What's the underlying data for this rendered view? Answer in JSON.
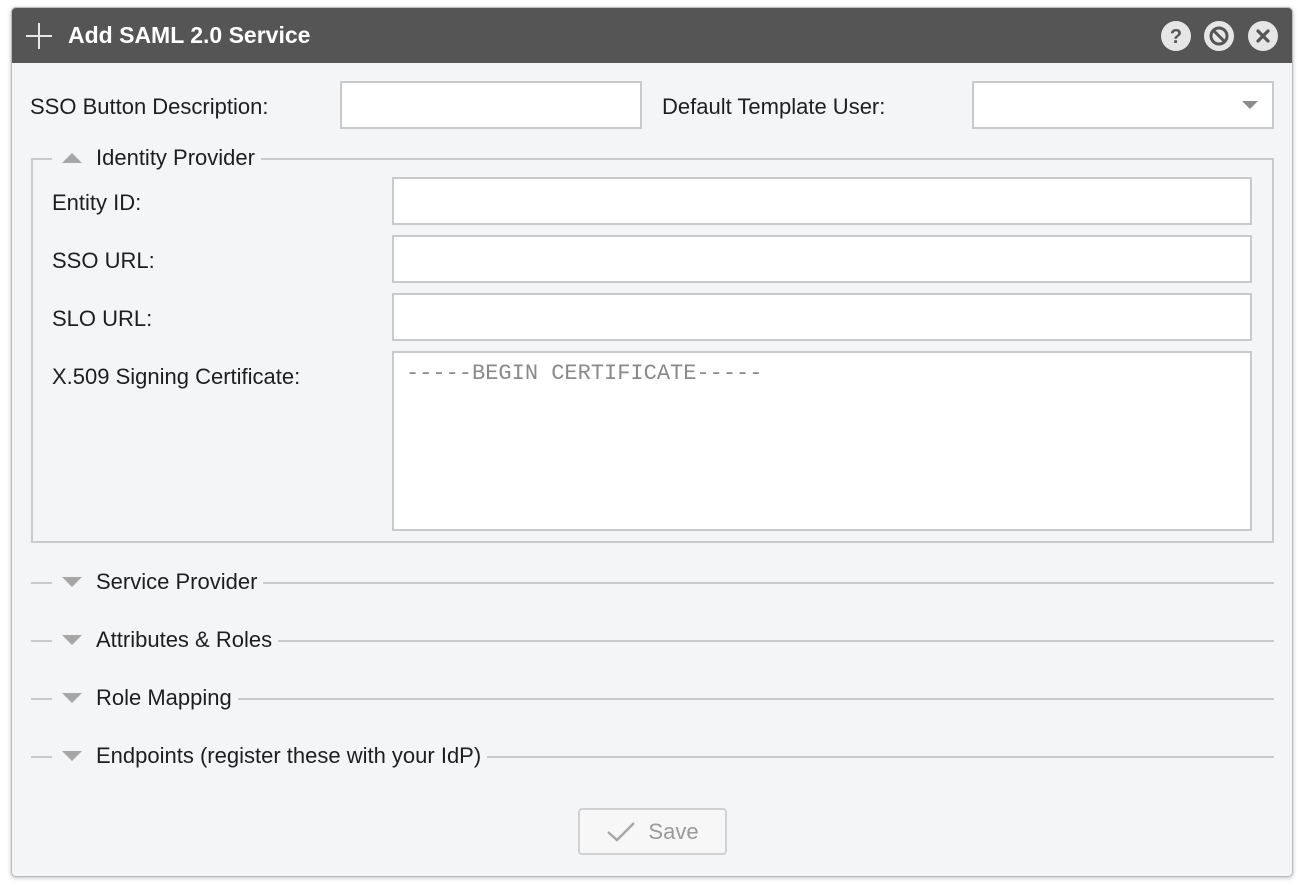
{
  "dialog": {
    "title": "Add SAML 2.0 Service",
    "icons": {
      "add": "plus-icon",
      "help": "help-icon",
      "minimize": "disable-icon",
      "close": "close-icon"
    }
  },
  "form": {
    "sso_button_description": {
      "label": "SSO Button Description:",
      "value": ""
    },
    "default_template_user": {
      "label": "Default Template User:",
      "value": ""
    }
  },
  "identity_provider": {
    "legend": "Identity Provider",
    "expanded": true,
    "entity_id": {
      "label": "Entity ID:",
      "value": ""
    },
    "sso_url": {
      "label": "SSO URL:",
      "value": ""
    },
    "slo_url": {
      "label": "SLO URL:",
      "value": ""
    },
    "certificate": {
      "label": "X.509 Signing Certificate:",
      "placeholder": "-----BEGIN CERTIFICATE-----"
    }
  },
  "sections": [
    {
      "label": "Service Provider",
      "expanded": false
    },
    {
      "label": "Attributes & Roles",
      "expanded": false
    },
    {
      "label": "Role Mapping",
      "expanded": false
    },
    {
      "label": "Endpoints (register these with your IdP)",
      "expanded": false
    }
  ],
  "actions": {
    "save_label": "Save",
    "save_enabled": false
  },
  "colors": {
    "titlebar": "#555555",
    "background": "#f4f5f7",
    "border": "#c9cacc"
  }
}
